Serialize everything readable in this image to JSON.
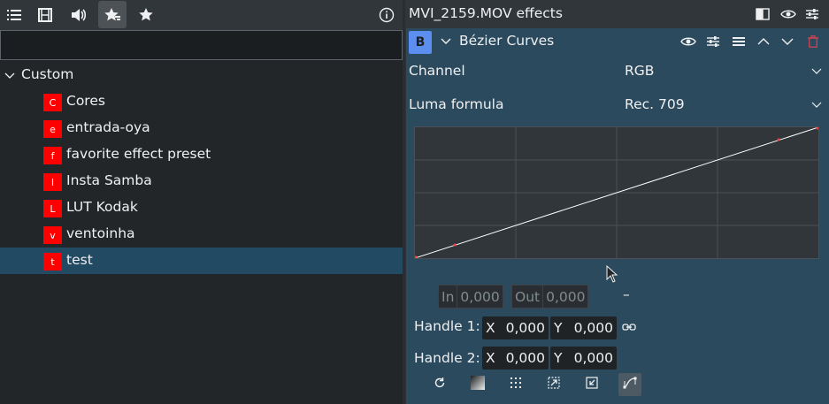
{
  "left_panel": {
    "toolbar": {
      "icons": [
        "list-icon",
        "film-icon",
        "audio-icon",
        "star-effects-icon",
        "star-icon",
        "info-icon"
      ],
      "active_index": 3
    },
    "search": {
      "value": "",
      "placeholder": ""
    },
    "tree": {
      "root_label": "Custom",
      "items": [
        {
          "badge": "C",
          "label": "Cores"
        },
        {
          "badge": "e",
          "label": "entrada-oya"
        },
        {
          "badge": "f",
          "label": "favorite effect preset"
        },
        {
          "badge": "I",
          "label": "Insta Samba"
        },
        {
          "badge": "L",
          "label": "LUT Kodak"
        },
        {
          "badge": "v",
          "label": "ventoinha"
        },
        {
          "badge": "t",
          "label": "test"
        }
      ],
      "selected_index": 6
    }
  },
  "right_panel": {
    "title": "MVI_2159.MOV effects",
    "effect": {
      "badge": "B",
      "name": "Bézier Curves",
      "channel": {
        "label": "Channel",
        "value": "RGB"
      },
      "luma": {
        "label": "Luma formula",
        "value": "Rec. 709"
      },
      "in": {
        "label": "In",
        "value": "0,000"
      },
      "out": {
        "label": "Out",
        "value": "0,000"
      },
      "handle1": {
        "label": "Handle 1:",
        "x_axis": "X",
        "x": "0,000",
        "y_axis": "Y",
        "y": "0,000"
      },
      "handle2": {
        "label": "Handle 2:",
        "x_axis": "X",
        "x": "0,000",
        "y_axis": "Y",
        "y": "0,000"
      },
      "minus_symbol": "–"
    },
    "colors": {
      "accent": "#5c8ef0",
      "effect_bg": "#2b4a5e",
      "selection": "#234a63",
      "badge": "#ff0000",
      "curve": "#ffffff",
      "point": "#ff4040"
    }
  }
}
